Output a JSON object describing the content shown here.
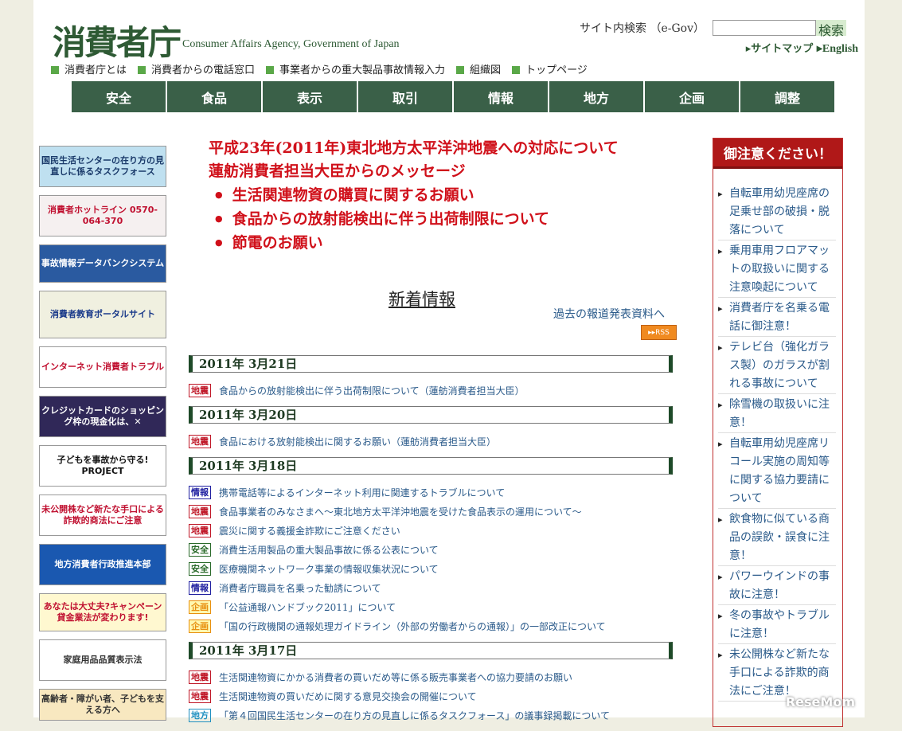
{
  "header": {
    "logo": "消費者庁",
    "logo_en": "Consumer Affairs Agency, Government of Japan",
    "search_label": "サイト内検索 （e-Gov）",
    "search_button": "検索",
    "sitemap": "▸サイトマップ",
    "english": "▸English"
  },
  "toplinks": [
    "消費者庁とは",
    "消費者からの電話窓口",
    "事業者からの重大製品事故情報入力",
    "組織図",
    "トップページ"
  ],
  "nav": [
    "安全",
    "食品",
    "表示",
    "取引",
    "情報",
    "地方",
    "企画",
    "調整"
  ],
  "banners": [
    {
      "text": "国民生活センターの在り方の見直しに係るタスクフォース",
      "bg": "#bfe0f0",
      "fg": "#1a3a6a",
      "h": 52
    },
    {
      "text": "消費者ホットライン 0570-064-370",
      "bg": "#f5f0f0",
      "fg": "#c01030",
      "h": 52
    },
    {
      "text": "事故情報データバンクシステム",
      "bg": "#2a5aa0",
      "fg": "#fff",
      "h": 48
    },
    {
      "text": "消費者教育ポータルサイト",
      "bg": "#f0f0e0",
      "fg": "#1a3a8a",
      "h": 60
    },
    {
      "text": "インターネット消費者トラブル",
      "bg": "#fff",
      "fg": "#c01030",
      "h": 52
    },
    {
      "text": "クレジットカードのショッピング枠の現金化は、✕",
      "bg": "#302858",
      "fg": "#fff",
      "h": 52
    },
    {
      "text": "子どもを事故から守る! PROJECT",
      "bg": "#fff",
      "fg": "#111",
      "h": 52
    },
    {
      "text": "未公開株など新たな手口による詐欺的商法にご注意",
      "bg": "#fff",
      "fg": "#c01030",
      "h": 52
    },
    {
      "text": "地方消費者行政推進本部",
      "bg": "#1a58b0",
      "fg": "#fff",
      "h": 52
    },
    {
      "text": "あなたは大丈夫?キャンペーン 貸金業法が変わります!",
      "bg": "#fff8d0",
      "fg": "#c01030",
      "h": 48
    },
    {
      "text": "家庭用品品質表示法",
      "bg": "#fff",
      "fg": "#333",
      "h": 52
    },
    {
      "text": "高齢者・障がい者、子どもを支える方へ",
      "bg": "#f8e8c0",
      "fg": "#333",
      "h": 40
    }
  ],
  "alert": {
    "line1": "平成23年(2011年)東北地方太平洋沖地震への対応について",
    "line2": "蓮舫消費者担当大臣からのメッセージ",
    "items": [
      "生活関連物資の購買に関するお願い",
      "食品からの放射能検出に伴う出荷制限について",
      "節電のお願い"
    ]
  },
  "news": {
    "title": "新着情報",
    "past_link": "過去の報道発表資料へ",
    "rss": "▸▸RSS",
    "groups": [
      {
        "date": "2011年 3月21日",
        "items": [
          {
            "tag": "地震",
            "text": "食品からの放射能検出に伴う出荷制限について（蓮舫消費者担当大臣）"
          }
        ]
      },
      {
        "date": "2011年 3月20日",
        "items": [
          {
            "tag": "地震",
            "text": "食品における放射能検出に関するお願い（蓮舫消費者担当大臣）"
          }
        ]
      },
      {
        "date": "2011年 3月18日",
        "items": [
          {
            "tag": "情報",
            "text": "携帯電話等によるインターネット利用に関連するトラブルについて"
          },
          {
            "tag": "地震",
            "text": "食品事業者のみなさまへ～東北地方太平洋沖地震を受けた食品表示の運用について～"
          },
          {
            "tag": "地震",
            "text": "震災に関する義援金詐欺にご注意ください"
          },
          {
            "tag": "安全",
            "text": "消費生活用製品の重大製品事故に係る公表について"
          },
          {
            "tag": "安全",
            "text": "医療機関ネットワーク事業の情報収集状況について"
          },
          {
            "tag": "情報",
            "text": "消費者庁職員を名乗った勧誘について"
          },
          {
            "tag": "企画",
            "text": "「公益通報ハンドブック2011」について"
          },
          {
            "tag": "企画",
            "text": "「国の行政機関の通報処理ガイドライン（外部の労働者からの通報）」の一部改正について"
          }
        ]
      },
      {
        "date": "2011年 3月17日",
        "items": [
          {
            "tag": "地震",
            "text": "生活関連物資にかかる消費者の買いだめ等に係る販売事業者への協力要請のお願い"
          },
          {
            "tag": "地震",
            "text": "生活関連物資の買いだめに関する意見交換会の開催について"
          },
          {
            "tag": "地方",
            "text": "「第４回国民生活センターの在り方の見直しに係るタスクフォース」の議事録掲載について"
          }
        ]
      }
    ]
  },
  "tag_colors": {
    "地震": "#c01828",
    "情報": "#2020a0",
    "安全": "#2a6a2a",
    "企画": "#e89010",
    "地方": "#2090c0"
  },
  "side": {
    "title": "御注意ください！",
    "items": [
      "自転車用幼児座席の足乗せ部の破損・脱落について",
      "乗用車用フロアマットの取扱いに関する注意喚起について",
      "消費者庁を名乗る電話に御注意！",
      "テレビ台（強化ガラス製）のガラスが割れる事故について",
      "除雪機の取扱いに注意！",
      "自転車用幼児座席リコール実施の周知等に関する協力要請について",
      "飲食物に似ている商品の誤飲・誤食に注意！",
      "パワーウインドの事故に注意！",
      "冬の事故やトラブルに注意！",
      "未公開株など新たな手口による詐欺的商法にご注意！"
    ]
  },
  "watermark": "ReseMom"
}
